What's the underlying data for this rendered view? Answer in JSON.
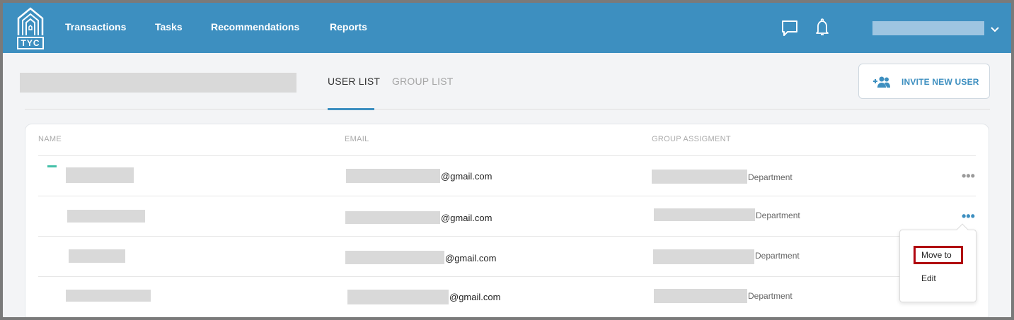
{
  "brand": {
    "logo_text": "TYC"
  },
  "nav": {
    "items": [
      {
        "label": "Transactions"
      },
      {
        "label": "Tasks"
      },
      {
        "label": "Recommendations"
      },
      {
        "label": "Reports"
      }
    ],
    "icons": [
      "chat-icon",
      "bell-icon",
      "chevron-down-icon"
    ],
    "accent_color": "#3d8fc0"
  },
  "tabs": [
    {
      "label": "USER LIST",
      "active": true
    },
    {
      "label": "GROUP LIST",
      "active": false
    }
  ],
  "invite_button": {
    "label": "INVITE NEW USER",
    "icon": "add-user-icon"
  },
  "table": {
    "columns": [
      "NAME",
      "EMAIL",
      "GROUP ASSIGMENT"
    ],
    "rows": [
      {
        "email_suffix": "@gmail.com",
        "group_suffix": "Department"
      },
      {
        "email_suffix": "@gmail.com",
        "group_suffix": "Department"
      },
      {
        "email_suffix": "@gmail.com",
        "group_suffix": "Department"
      },
      {
        "email_suffix": "@gmail.com",
        "group_suffix": "Department"
      }
    ]
  },
  "row_menu": {
    "items": [
      {
        "label": "Move to"
      },
      {
        "label": "Edit"
      }
    ]
  }
}
